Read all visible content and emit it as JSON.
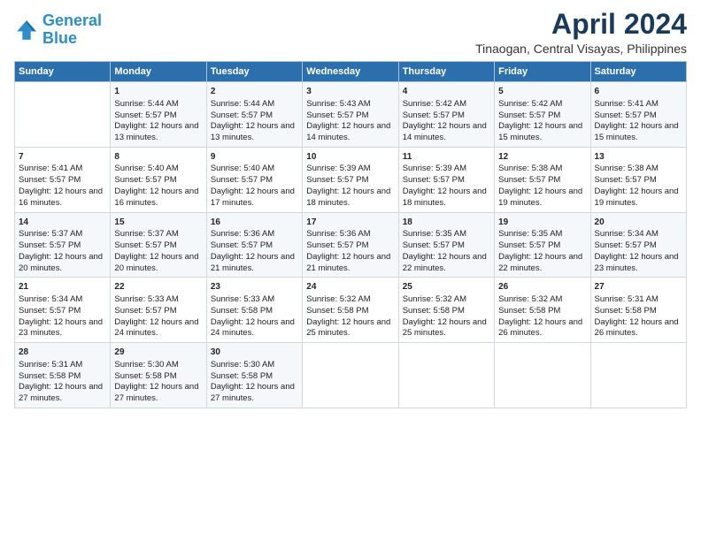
{
  "logo": {
    "line1": "General",
    "line2": "Blue"
  },
  "title": "April 2024",
  "subtitle": "Tinaogan, Central Visayas, Philippines",
  "headers": [
    "Sunday",
    "Monday",
    "Tuesday",
    "Wednesday",
    "Thursday",
    "Friday",
    "Saturday"
  ],
  "weeks": [
    [
      {
        "day": "",
        "sunrise": "",
        "sunset": "",
        "daylight": ""
      },
      {
        "day": "1",
        "sunrise": "Sunrise: 5:44 AM",
        "sunset": "Sunset: 5:57 PM",
        "daylight": "Daylight: 12 hours and 13 minutes."
      },
      {
        "day": "2",
        "sunrise": "Sunrise: 5:44 AM",
        "sunset": "Sunset: 5:57 PM",
        "daylight": "Daylight: 12 hours and 13 minutes."
      },
      {
        "day": "3",
        "sunrise": "Sunrise: 5:43 AM",
        "sunset": "Sunset: 5:57 PM",
        "daylight": "Daylight: 12 hours and 14 minutes."
      },
      {
        "day": "4",
        "sunrise": "Sunrise: 5:42 AM",
        "sunset": "Sunset: 5:57 PM",
        "daylight": "Daylight: 12 hours and 14 minutes."
      },
      {
        "day": "5",
        "sunrise": "Sunrise: 5:42 AM",
        "sunset": "Sunset: 5:57 PM",
        "daylight": "Daylight: 12 hours and 15 minutes."
      },
      {
        "day": "6",
        "sunrise": "Sunrise: 5:41 AM",
        "sunset": "Sunset: 5:57 PM",
        "daylight": "Daylight: 12 hours and 15 minutes."
      }
    ],
    [
      {
        "day": "7",
        "sunrise": "Sunrise: 5:41 AM",
        "sunset": "Sunset: 5:57 PM",
        "daylight": "Daylight: 12 hours and 16 minutes."
      },
      {
        "day": "8",
        "sunrise": "Sunrise: 5:40 AM",
        "sunset": "Sunset: 5:57 PM",
        "daylight": "Daylight: 12 hours and 16 minutes."
      },
      {
        "day": "9",
        "sunrise": "Sunrise: 5:40 AM",
        "sunset": "Sunset: 5:57 PM",
        "daylight": "Daylight: 12 hours and 17 minutes."
      },
      {
        "day": "10",
        "sunrise": "Sunrise: 5:39 AM",
        "sunset": "Sunset: 5:57 PM",
        "daylight": "Daylight: 12 hours and 18 minutes."
      },
      {
        "day": "11",
        "sunrise": "Sunrise: 5:39 AM",
        "sunset": "Sunset: 5:57 PM",
        "daylight": "Daylight: 12 hours and 18 minutes."
      },
      {
        "day": "12",
        "sunrise": "Sunrise: 5:38 AM",
        "sunset": "Sunset: 5:57 PM",
        "daylight": "Daylight: 12 hours and 19 minutes."
      },
      {
        "day": "13",
        "sunrise": "Sunrise: 5:38 AM",
        "sunset": "Sunset: 5:57 PM",
        "daylight": "Daylight: 12 hours and 19 minutes."
      }
    ],
    [
      {
        "day": "14",
        "sunrise": "Sunrise: 5:37 AM",
        "sunset": "Sunset: 5:57 PM",
        "daylight": "Daylight: 12 hours and 20 minutes."
      },
      {
        "day": "15",
        "sunrise": "Sunrise: 5:37 AM",
        "sunset": "Sunset: 5:57 PM",
        "daylight": "Daylight: 12 hours and 20 minutes."
      },
      {
        "day": "16",
        "sunrise": "Sunrise: 5:36 AM",
        "sunset": "Sunset: 5:57 PM",
        "daylight": "Daylight: 12 hours and 21 minutes."
      },
      {
        "day": "17",
        "sunrise": "Sunrise: 5:36 AM",
        "sunset": "Sunset: 5:57 PM",
        "daylight": "Daylight: 12 hours and 21 minutes."
      },
      {
        "day": "18",
        "sunrise": "Sunrise: 5:35 AM",
        "sunset": "Sunset: 5:57 PM",
        "daylight": "Daylight: 12 hours and 22 minutes."
      },
      {
        "day": "19",
        "sunrise": "Sunrise: 5:35 AM",
        "sunset": "Sunset: 5:57 PM",
        "daylight": "Daylight: 12 hours and 22 minutes."
      },
      {
        "day": "20",
        "sunrise": "Sunrise: 5:34 AM",
        "sunset": "Sunset: 5:57 PM",
        "daylight": "Daylight: 12 hours and 23 minutes."
      }
    ],
    [
      {
        "day": "21",
        "sunrise": "Sunrise: 5:34 AM",
        "sunset": "Sunset: 5:57 PM",
        "daylight": "Daylight: 12 hours and 23 minutes."
      },
      {
        "day": "22",
        "sunrise": "Sunrise: 5:33 AM",
        "sunset": "Sunset: 5:57 PM",
        "daylight": "Daylight: 12 hours and 24 minutes."
      },
      {
        "day": "23",
        "sunrise": "Sunrise: 5:33 AM",
        "sunset": "Sunset: 5:58 PM",
        "daylight": "Daylight: 12 hours and 24 minutes."
      },
      {
        "day": "24",
        "sunrise": "Sunrise: 5:32 AM",
        "sunset": "Sunset: 5:58 PM",
        "daylight": "Daylight: 12 hours and 25 minutes."
      },
      {
        "day": "25",
        "sunrise": "Sunrise: 5:32 AM",
        "sunset": "Sunset: 5:58 PM",
        "daylight": "Daylight: 12 hours and 25 minutes."
      },
      {
        "day": "26",
        "sunrise": "Sunrise: 5:32 AM",
        "sunset": "Sunset: 5:58 PM",
        "daylight": "Daylight: 12 hours and 26 minutes."
      },
      {
        "day": "27",
        "sunrise": "Sunrise: 5:31 AM",
        "sunset": "Sunset: 5:58 PM",
        "daylight": "Daylight: 12 hours and 26 minutes."
      }
    ],
    [
      {
        "day": "28",
        "sunrise": "Sunrise: 5:31 AM",
        "sunset": "Sunset: 5:58 PM",
        "daylight": "Daylight: 12 hours and 27 minutes."
      },
      {
        "day": "29",
        "sunrise": "Sunrise: 5:30 AM",
        "sunset": "Sunset: 5:58 PM",
        "daylight": "Daylight: 12 hours and 27 minutes."
      },
      {
        "day": "30",
        "sunrise": "Sunrise: 5:30 AM",
        "sunset": "Sunset: 5:58 PM",
        "daylight": "Daylight: 12 hours and 27 minutes."
      },
      {
        "day": "",
        "sunrise": "",
        "sunset": "",
        "daylight": ""
      },
      {
        "day": "",
        "sunrise": "",
        "sunset": "",
        "daylight": ""
      },
      {
        "day": "",
        "sunrise": "",
        "sunset": "",
        "daylight": ""
      },
      {
        "day": "",
        "sunrise": "",
        "sunset": "",
        "daylight": ""
      }
    ]
  ]
}
